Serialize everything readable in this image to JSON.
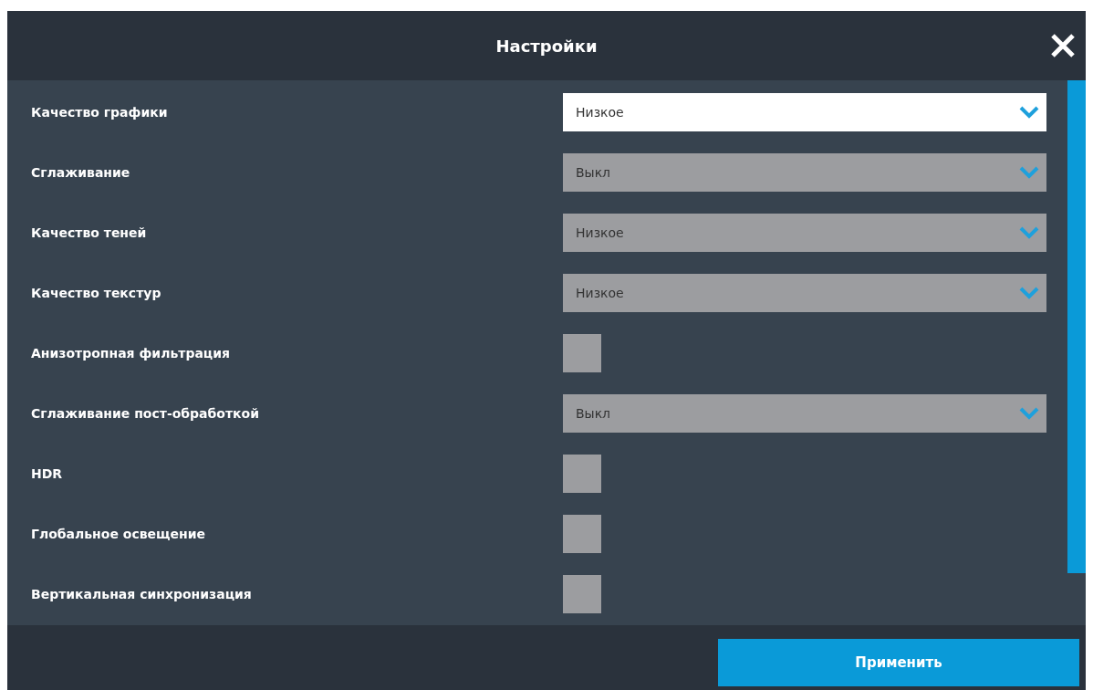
{
  "dialog": {
    "title": "Настройки"
  },
  "settings": [
    {
      "kind": "dropdown",
      "label": "Качество графики",
      "value": "Низкое",
      "disabled": false
    },
    {
      "kind": "dropdown",
      "label": "Сглаживание",
      "value": "Выкл",
      "disabled": true
    },
    {
      "kind": "dropdown",
      "label": "Качество теней",
      "value": "Низкое",
      "disabled": true
    },
    {
      "kind": "dropdown",
      "label": "Качество текстур",
      "value": "Низкое",
      "disabled": true
    },
    {
      "kind": "checkbox",
      "label": "Анизотропная фильтрация",
      "checked": false
    },
    {
      "kind": "dropdown",
      "label": "Сглаживание пост-обработкой",
      "value": "Выкл",
      "disabled": true
    },
    {
      "kind": "checkbox",
      "label": "HDR",
      "checked": false
    },
    {
      "kind": "checkbox",
      "label": "Глобальное освещение",
      "checked": false
    },
    {
      "kind": "checkbox",
      "label": "Вертикальная синхронизация",
      "checked": false
    }
  ],
  "footer": {
    "button": "Применить"
  }
}
